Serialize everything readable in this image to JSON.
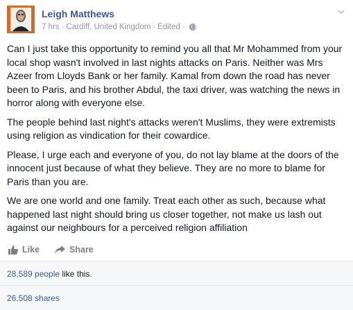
{
  "author": {
    "name": "Leigh Matthews"
  },
  "meta": {
    "time": "7 hrs",
    "sep1": "·",
    "location": "Cardiff, United Kingdom",
    "sep2": "·",
    "edited": "Edited",
    "sep3": "·"
  },
  "post": {
    "paragraphs": [
      "Can I just take this opportunity to remind you all that Mr Mohammed from your local shop wasn't involved in last nights attacks on Paris. Neither was Mrs Azeer from Lloyds Bank or her family. Kamal from down the road has never been to Paris, and his brother Abdul, the taxi driver, was watching the news in horror along with everyone else.",
      "The people behind last night's attacks weren't Muslims, they were extremists using religion as vindication for their cowardice.",
      "Please, I urge each and everyone of you, do not lay blame at the doors of the innocent just because of what they believe. They are no more to blame for Paris than you are.",
      "We are one world and one family. Treat each other as such, because what happened last night should bring us closer together, not make us lash out against our neighbours for a perceived religion affiliation"
    ]
  },
  "actions": {
    "like": "Like",
    "share": "Share"
  },
  "stats": {
    "likes_count": "28,589 people",
    "likes_suffix": " like this.",
    "shares": "26,508 shares"
  },
  "colors": {
    "link": "#3b5998",
    "meta": "#9197a3",
    "avatar_bg": "#d26a2a"
  },
  "icons": {
    "avatar": "man-portrait",
    "privacy": "globe-icon",
    "menu": "chevron-down-icon",
    "like": "thumbs-up-icon",
    "share": "share-arrow-icon"
  }
}
